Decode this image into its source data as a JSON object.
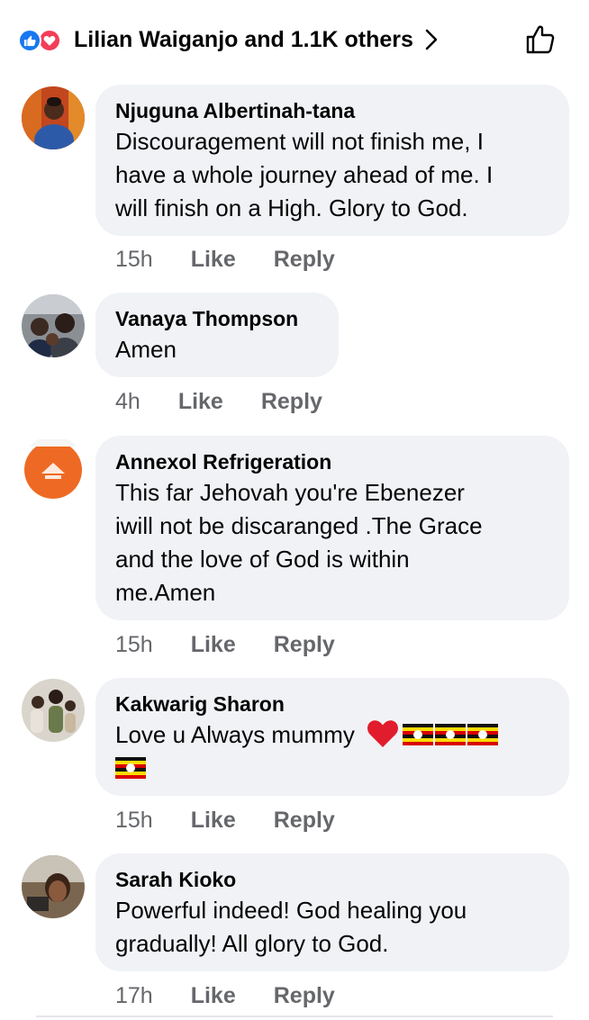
{
  "reactions": {
    "summary": "Lilian Waiganjo and 1.1K others",
    "icons": [
      "like-icon",
      "love-icon"
    ]
  },
  "actions_labels": {
    "like": "Like",
    "reply": "Reply"
  },
  "comments": [
    {
      "author": "Njuguna Albertinah-tana",
      "lines": [
        "Discouragement will not finish me, I",
        "have a whole journey ahead of me. I",
        "will finish on a High. Glory to God."
      ],
      "time": "15h"
    },
    {
      "author": "Vanaya Thompson",
      "lines": [
        "Amen"
      ],
      "time": "4h"
    },
    {
      "author": "Annexol Refrigeration",
      "lines": [
        "This far Jehovah you're Ebenezer",
        "iwill not be discaranged .The Grace",
        "and the love of God is within",
        "me.Amen"
      ],
      "time": "15h"
    },
    {
      "author": "Kakwarig Sharon",
      "lines": [
        "Love u Always mummy"
      ],
      "emoji": [
        "red-heart",
        "uganda-flag",
        "uganda-flag",
        "uganda-flag",
        "uganda-flag"
      ],
      "time": "15h"
    },
    {
      "author": "Sarah Kioko",
      "lines": [
        "Powerful indeed! God healing you",
        "gradually! All glory to God."
      ],
      "time": "17h"
    }
  ],
  "colors": {
    "bubble_bg": "#f0f2f5",
    "meta_text": "#65676b",
    "like_blue": "#1877f2",
    "love_red": "#f33e58"
  }
}
